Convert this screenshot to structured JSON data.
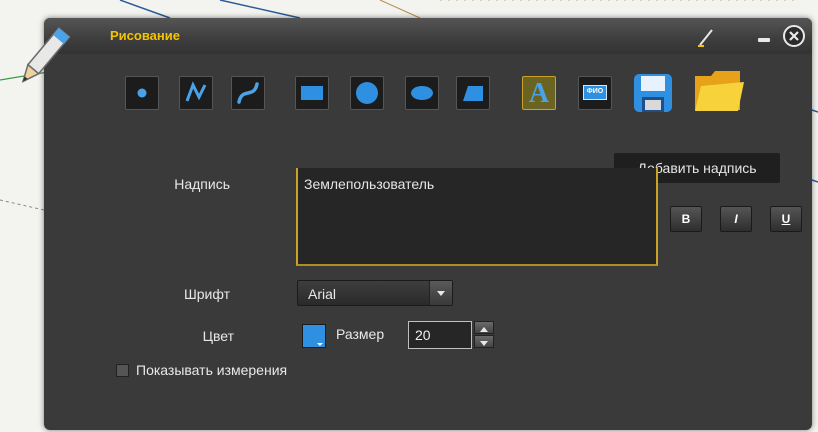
{
  "dialog": {
    "title": "Рисование",
    "minimize_label": "–",
    "close_label": "✕"
  },
  "toolbar": {
    "tools": [
      {
        "icon": "point-icon"
      },
      {
        "icon": "polyline-icon"
      },
      {
        "icon": "curve-icon"
      },
      {
        "icon": "rectangle-icon"
      },
      {
        "icon": "circle-icon"
      },
      {
        "icon": "ellipse-icon"
      },
      {
        "icon": "polygon-icon"
      },
      {
        "icon": "text-icon",
        "label": "A",
        "active": true
      },
      {
        "icon": "fio-icon",
        "label": "ФИО"
      },
      {
        "icon": "save-icon"
      },
      {
        "icon": "open-folder-icon"
      }
    ],
    "tooltip": "Добавить надпись"
  },
  "form": {
    "caption_label": "Надпись",
    "caption_value": "Землепользователь",
    "bold_label": "B",
    "italic_label": "I",
    "underline_label": "U",
    "font_label": "Шрифт",
    "font_value": "Arial",
    "color_label": "Цвет",
    "color_value": "#2f8fe0",
    "size_label": "Размер",
    "size_value": "20",
    "measure_label": "Показывать измерения",
    "measure_checked": false
  },
  "colors": {
    "accent": "#f5c400",
    "dialog_bg": "#3a3a3a",
    "tooltip_bg": "#1f1f1f"
  }
}
